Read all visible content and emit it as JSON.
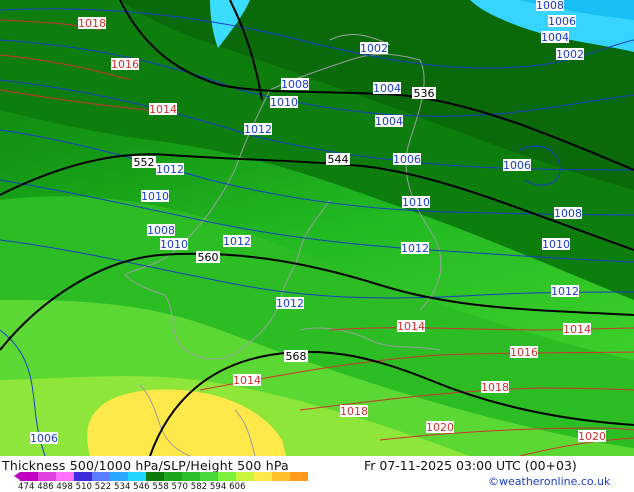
{
  "title": "Thickness 500/1000 hPa/SLP/Height 500 hPa",
  "valid_time": "Fr 07-11-2025 03:00 UTC (00+03)",
  "credit": "©weatheronline.co.uk",
  "scale": {
    "ticks": [
      "474",
      "486",
      "498",
      "510",
      "522",
      "534",
      "546",
      "558",
      "570",
      "582",
      "594",
      "606"
    ],
    "colors": [
      "#c000c0",
      "#e040e0",
      "#ff70ff",
      "#3a2bd8",
      "#5a7cff",
      "#2aa8ff",
      "#1fd6ff",
      "#0e7a0e",
      "#1ea51e",
      "#2bbf2b",
      "#49d83a",
      "#7cf23a",
      "#c8f53c",
      "#ffe84a",
      "#ffc02a",
      "#ff9a1a"
    ]
  },
  "slp_labels_blue": [
    "1008",
    "1006",
    "1004",
    "1002",
    "1004",
    "1002",
    "1008",
    "1010",
    "1004",
    "1012",
    "1006",
    "1012",
    "1006",
    "1010",
    "1008",
    "1010",
    "1008",
    "1010",
    "1012",
    "1012",
    "1010",
    "1008",
    "1012",
    "1010",
    "1012",
    "1006"
  ],
  "slp_labels_red": [
    "1018",
    "1016",
    "1014",
    "1014",
    "1016",
    "1014",
    "1018",
    "1018",
    "1020",
    "1020",
    "1014"
  ],
  "height_labels": [
    "536",
    "544",
    "552",
    "560",
    "568"
  ],
  "colors": {
    "dark_green": "#0a6e0a",
    "green": "#18a018",
    "light_green": "#3ccb2a",
    "lime": "#7ae032",
    "yellow": "#ffe84a",
    "sea_blue": "#2ad0ff",
    "isobar_blue": "#1a3cc8",
    "isobar_red": "#d03030",
    "height_black": "#000000"
  }
}
